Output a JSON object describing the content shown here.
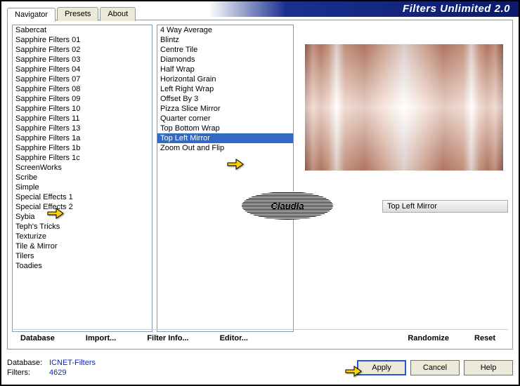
{
  "app_title": "Filters Unlimited 2.0",
  "tabs": [
    "Navigator",
    "Presets",
    "About"
  ],
  "active_tab": 0,
  "categories": [
    "Sabercat",
    "Sapphire Filters 01",
    "Sapphire Filters 02",
    "Sapphire Filters 03",
    "Sapphire Filters 04",
    "Sapphire Filters 07",
    "Sapphire Filters 08",
    "Sapphire Filters 09",
    "Sapphire Filters 10",
    "Sapphire Filters 11",
    "Sapphire Filters 13",
    "Sapphire Filters 1a",
    "Sapphire Filters 1b",
    "Sapphire Filters 1c",
    "ScreenWorks",
    "Scribe",
    "Simple",
    "Special Effects 1",
    "Special Effects 2",
    "Sybia",
    "Teph's Tricks",
    "Texturize",
    "Tile & Mirror",
    "Tilers",
    "Toadies"
  ],
  "selected_category": "Simple",
  "filters": [
    "4 Way Average",
    "Blintz",
    "Centre Tile",
    "Diamonds",
    "Half Wrap",
    "Horizontal Grain",
    "Left Right Wrap",
    "Offset By 3",
    "Pizza Slice Mirror",
    "Quarter corner",
    "Top Bottom Wrap",
    "Top Left Mirror",
    "Zoom Out and Flip"
  ],
  "selected_filter": "Top Left Mirror",
  "current_filter_label": "Top Left Mirror",
  "logo_text": "Claudia",
  "toolbar": {
    "database": "Database",
    "import": "Import...",
    "filter_info": "Filter Info...",
    "editor": "Editor...",
    "randomize": "Randomize",
    "reset": "Reset"
  },
  "status": {
    "db_label": "Database:",
    "db_value": "ICNET-Filters",
    "filters_label": "Filters:",
    "filters_value": "4629"
  },
  "buttons": {
    "apply": "Apply",
    "cancel": "Cancel",
    "help": "Help"
  }
}
